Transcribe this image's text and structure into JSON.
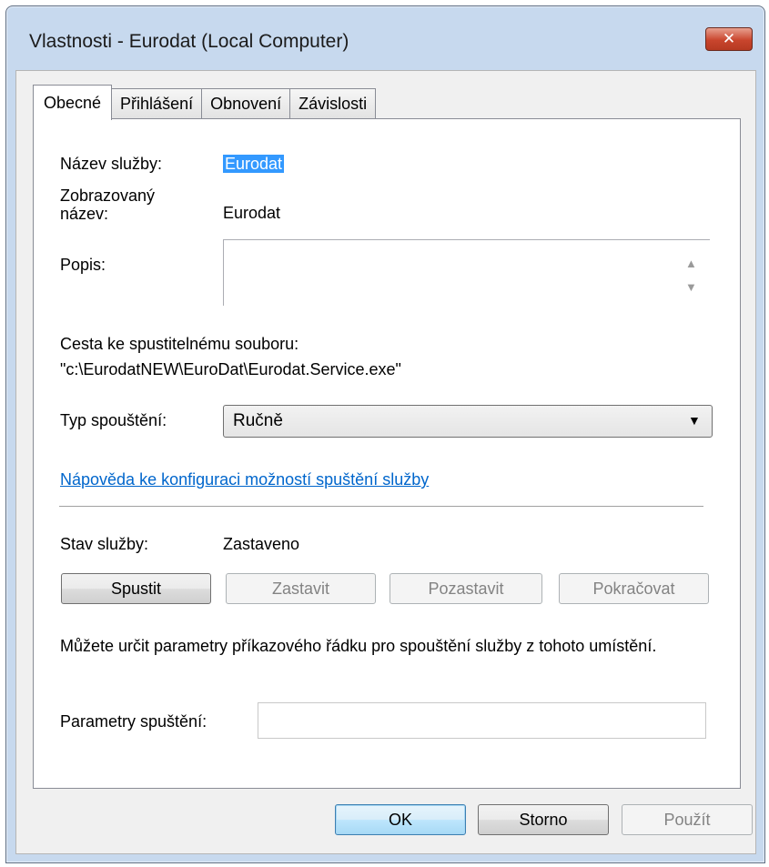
{
  "window": {
    "title": "Vlastnosti - Eurodat (Local Computer)",
    "close_glyph": "✕"
  },
  "tabs": [
    {
      "label": "Obecné",
      "active": true
    },
    {
      "label": "Přihlášení",
      "active": false
    },
    {
      "label": "Obnovení",
      "active": false
    },
    {
      "label": "Závislosti",
      "active": false
    }
  ],
  "general": {
    "service_name_label": "Název služby:",
    "service_name_value": "Eurodat",
    "display_name_label": "Zobrazovaný název:",
    "display_name_value": "Eurodat",
    "description_label": "Popis:",
    "description_value": "",
    "exe_path_label": "Cesta ke spustitelnému souboru:",
    "exe_path_value": "\"c:\\EurodatNEW\\EuroDat\\Eurodat.Service.exe\"",
    "startup_type_label": "Typ spouštění:",
    "startup_type_value": "Ručně",
    "help_link": "Nápověda ke konfiguraci možností spuštění služby",
    "status_label": "Stav služby:",
    "status_value": "Zastaveno",
    "buttons": {
      "start": "Spustit",
      "stop": "Zastavit",
      "pause": "Pozastavit",
      "resume": "Pokračovat"
    },
    "params_hint": "Můžete určit parametry příkazového řádku pro spouštění služby z tohoto umístění.",
    "params_label": "Parametry spuštění:",
    "params_value": ""
  },
  "footer": {
    "ok": "OK",
    "cancel": "Storno",
    "apply": "Použít"
  }
}
